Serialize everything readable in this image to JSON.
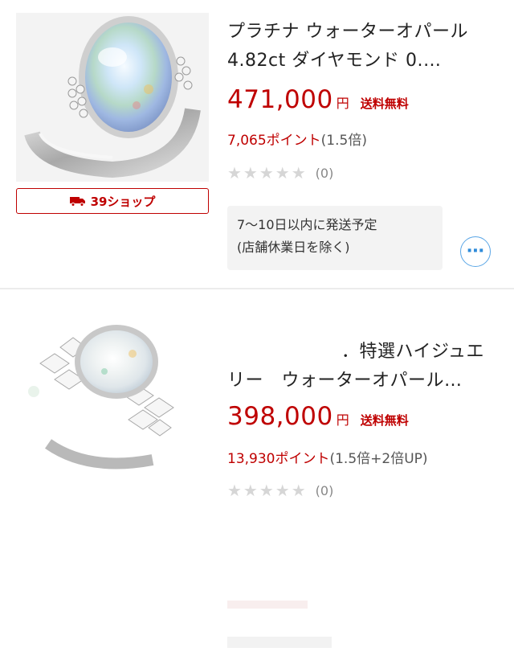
{
  "listings": [
    {
      "title": "プラチナ ウォーターオパール 4.82ct ダイヤモンド 0.…",
      "price": "471,000",
      "currency": "円",
      "shipping": "送料無料",
      "points": "7,065ポイント",
      "points_rate": "(1.5倍)",
      "stars": "★★★★★",
      "review_count": "(0)",
      "shop_button": "39ショップ",
      "delivery_line1": "7〜10日以内に発送予定",
      "delivery_line2": "(店舗休業日を除く)",
      "more_icon": "ellipsis-icon"
    },
    {
      "title": "．特選ハイジュエリー　ウォーターオパール…",
      "price": "398,000",
      "currency": "円",
      "shipping": "送料無料",
      "points": "13,930ポイント",
      "points_rate": "(1.5倍+2倍UP)",
      "stars": "★★★★★",
      "review_count": "(0)"
    }
  ],
  "colors": {
    "accent": "#bf0000",
    "star_empty": "#d6d6d6",
    "link_blue": "#2f8bd9"
  }
}
